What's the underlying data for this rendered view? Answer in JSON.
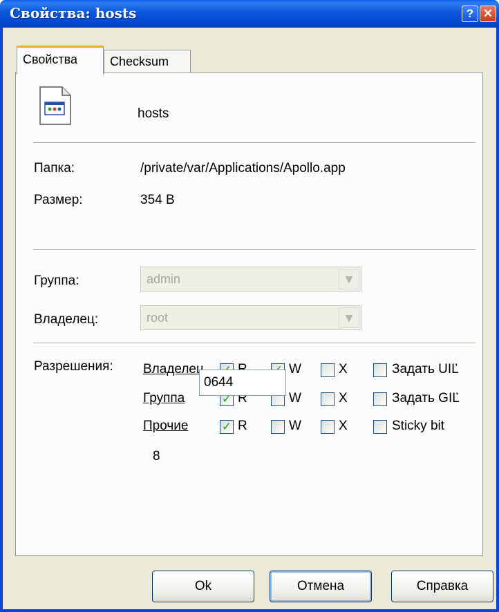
{
  "window": {
    "title": "Свойства: hosts",
    "help_glyph": "?",
    "close_glyph": "✕"
  },
  "tabs": [
    {
      "label": "Свойства",
      "active": true
    },
    {
      "label": "Checksum",
      "active": false
    }
  ],
  "file": {
    "icon": "file-document-icon",
    "name": "hosts"
  },
  "info": {
    "folder_label": "Папка:",
    "folder_value": "/private/var/Applications/Apollo.app",
    "size_label": "Размер:",
    "size_value": "354 B"
  },
  "ownership": {
    "group_label": "Группа:",
    "group_value": "admin",
    "owner_label": "Владелец:",
    "owner_value": "root"
  },
  "permissions": {
    "label": "Разрешения:",
    "rows": [
      {
        "name": "Владелец",
        "r": true,
        "w": true,
        "x": false,
        "special_label": "Задать UIĽ",
        "special": false
      },
      {
        "name": "Группа",
        "r": true,
        "w": false,
        "x": false,
        "special_label": "Задать GIĽ",
        "special": false
      },
      {
        "name": "Прочие",
        "r": true,
        "w": false,
        "x": false,
        "special_label": "Sticky bit",
        "special": false
      }
    ],
    "r_label": "R",
    "w_label": "W",
    "x_label": "X",
    "base_label": "8",
    "octal_value": "0644"
  },
  "buttons": {
    "ok": "Ok",
    "cancel": "Отмена",
    "help": "Справка"
  },
  "colors": {
    "titlebar": "#0b57dc",
    "tab_highlight": "#f7a623",
    "check": "#21a121"
  }
}
